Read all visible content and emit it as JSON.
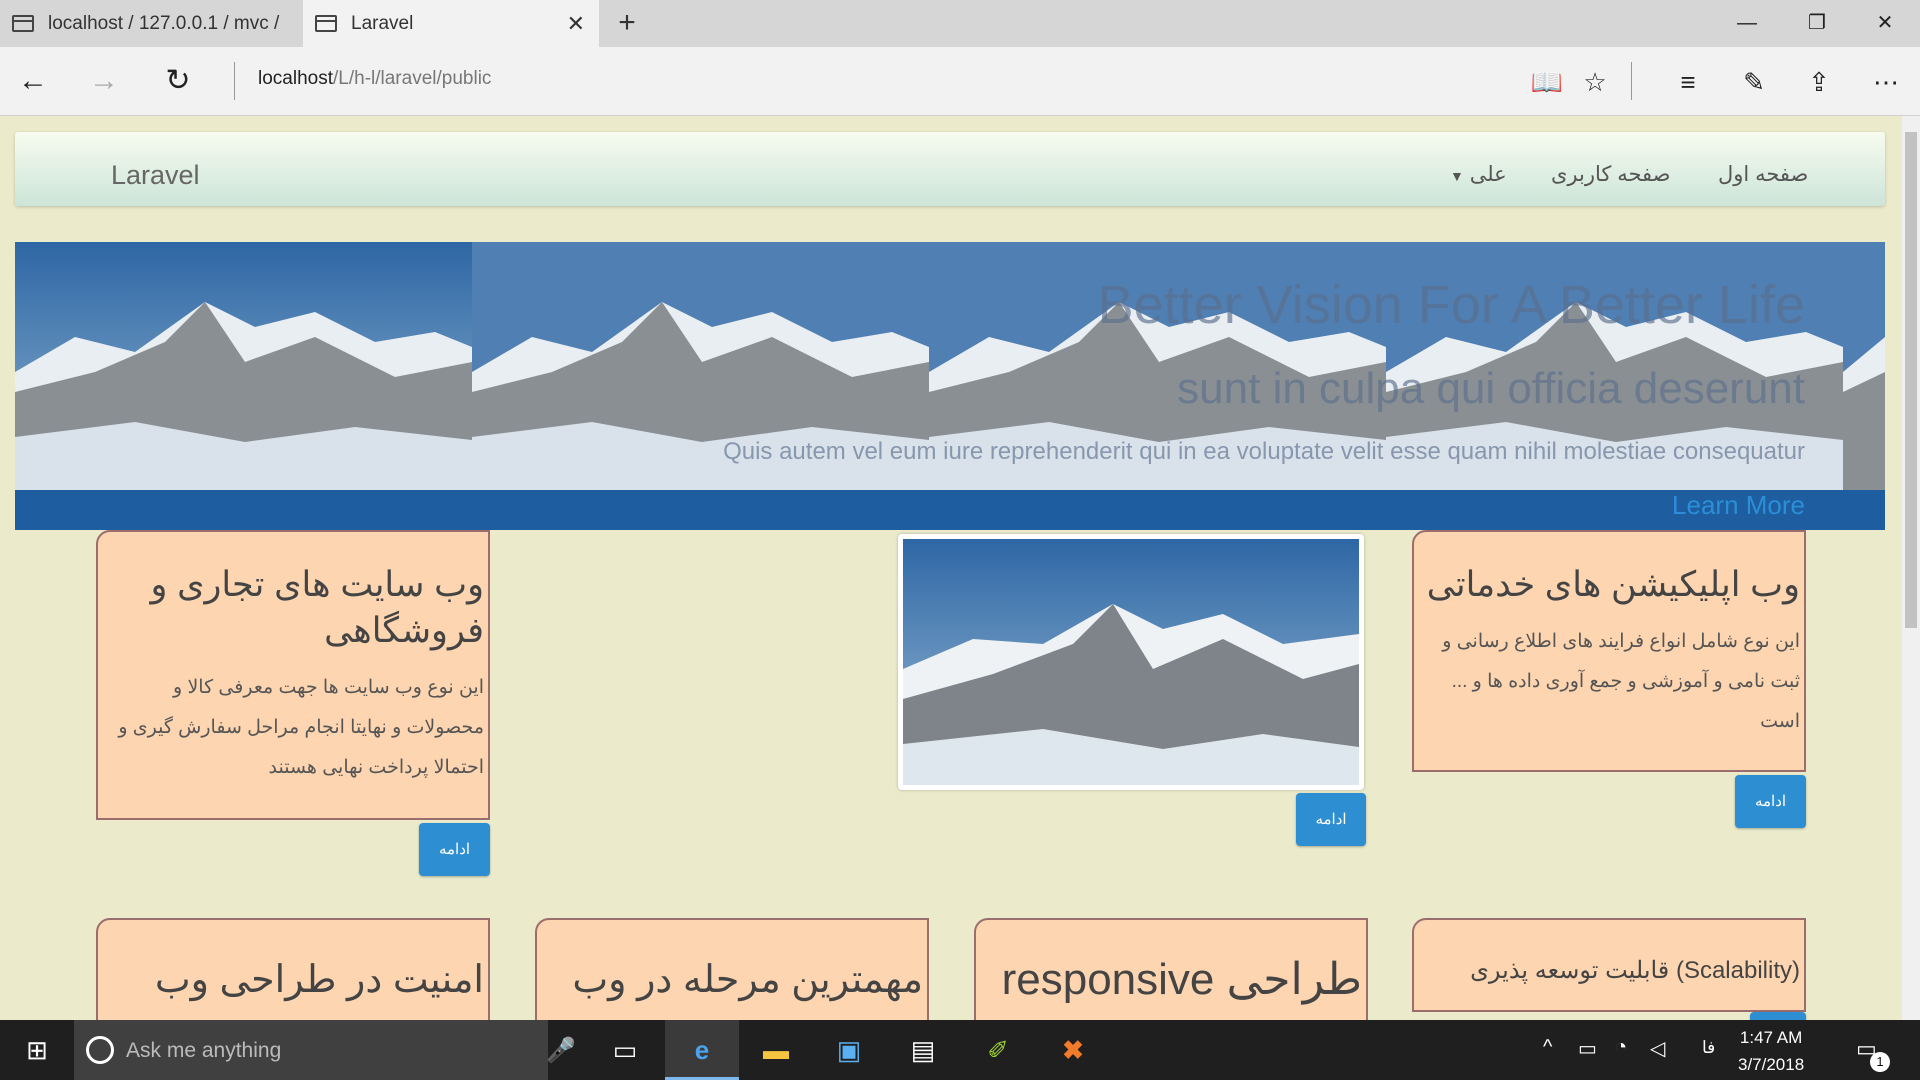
{
  "browser": {
    "tabs": [
      {
        "title": "localhost / 127.0.0.1 / mvc /"
      },
      {
        "title": "Laravel"
      }
    ],
    "url_host": "localhost",
    "url_path": "/L/h-l/laravel/public"
  },
  "site": {
    "brand": "Laravel",
    "nav": {
      "home": "صفحه اول",
      "user_page": "صفحه کاربری",
      "user_menu": "علی"
    },
    "hero": {
      "title": "Better Vision For A Better Life",
      "subtitle": "sunt in culpa qui officia deserunt",
      "text": "Quis autem vel eum iure reprehenderit qui in ea voluptate velit esse quam nihil molestiae consequatur",
      "cta": "Learn More"
    },
    "cards_row1": [
      {
        "title": "وب سایت های تجاری و فروشگاهی",
        "text": "این نوع وب سایت ها جهت معرفی کالا و محصولات و نهایتا انجام مراحل سفارش گیری و احتمالا پرداخت نهایی هستند",
        "button": "ادامه"
      },
      {
        "title": "وب اپلیکیشن های خدماتی",
        "text": "این نوع شامل انواع فرایند های اطلاع رسانی و ثبت نامی و آموزشی و جمع آوری داده ها و ... است",
        "button": "ادامه"
      },
      {
        "button": "ادامه"
      }
    ],
    "cards_row2": [
      {
        "title": "امنیت در طراحی وب"
      },
      {
        "title": "مهمترین مرحله در وب"
      },
      {
        "title": "طراحی responsive"
      },
      {
        "title": "(Scalability) قابلیت توسعه پذیری"
      }
    ]
  },
  "taskbar": {
    "search_placeholder": "Ask me anything",
    "language": "فا",
    "time": "1:47 AM",
    "date": "3/7/2018",
    "notifications": "1"
  },
  "colors": {
    "page_bg": "#ebebcc",
    "card_bg": "#fdd5b0",
    "button": "#2d8fd2",
    "link": "#2a8fd6"
  }
}
